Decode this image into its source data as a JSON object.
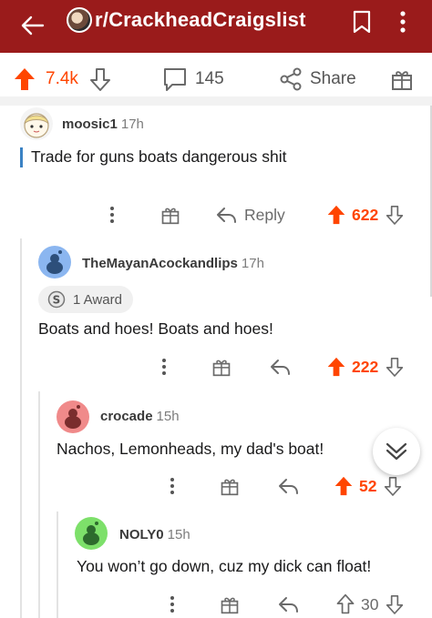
{
  "header": {
    "subreddit": "r/CrackheadCraigslist",
    "bg_color": "#9a1b1b"
  },
  "post_actions": {
    "upvotes": "7.4k",
    "comments": "145",
    "share_label": "Share",
    "accent_color": "#ff4500"
  },
  "comments": [
    {
      "username": "moosic1",
      "time": "17h",
      "body": "Trade for guns boats dangerous shit",
      "reply_label": "Reply",
      "score": "622",
      "upvoted": true
    },
    {
      "username": "TheMayanAcockandlips",
      "time": "17h",
      "award": "1 Award",
      "body": "Boats and hoes! Boats and hoes!",
      "score": "222",
      "upvoted": true
    },
    {
      "username": "crocade",
      "time": "15h",
      "body": "Nachos, Lemonheads, my dad's boat!",
      "score": "52",
      "upvoted": true
    },
    {
      "username": "NOLY0",
      "time": "15h",
      "body": "You won’t go down, cuz my dick can float!",
      "score": "30",
      "upvoted": false
    }
  ],
  "icons": {
    "back": "arrow-left-icon",
    "bookmark": "bookmark-icon",
    "more": "more-vertical-icon",
    "upvote": "arrow-up-icon",
    "downvote": "arrow-down-icon",
    "comment": "speech-bubble-icon",
    "share": "share-icon",
    "award": "gift-icon",
    "reply": "reply-arrow-icon",
    "scroll_down": "chevron-down-double-icon"
  }
}
